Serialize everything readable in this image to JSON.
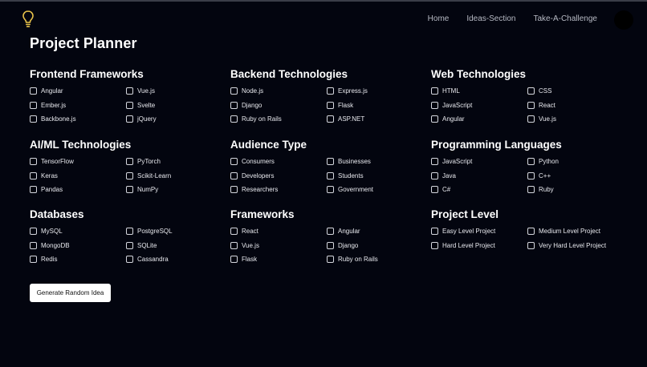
{
  "nav": {
    "links": [
      "Home",
      "Ideas-Section",
      "Take-A-Challenge"
    ],
    "logo_icon": "lightbulb-icon",
    "accent": "#e8c24a"
  },
  "page": {
    "title": "Project Planner"
  },
  "sections": [
    {
      "title": "Frontend Frameworks",
      "options": [
        "Angular",
        "Vue.js",
        "Ember.js",
        "Svelte",
        "Backbone.js",
        "jQuery"
      ]
    },
    {
      "title": "Backend Technologies",
      "options": [
        "Node.js",
        "Express.js",
        "Django",
        "Flask",
        "Ruby on Rails",
        "ASP.NET"
      ]
    },
    {
      "title": "Web Technologies",
      "options": [
        "HTML",
        "CSS",
        "JavaScript",
        "React",
        "Angular",
        "Vue.js"
      ]
    },
    {
      "title": "AI/ML Technologies",
      "options": [
        "TensorFlow",
        "PyTorch",
        "Keras",
        "Scikit-Learn",
        "Pandas",
        "NumPy"
      ]
    },
    {
      "title": "Audience Type",
      "options": [
        "Consumers",
        "Businesses",
        "Developers",
        "Students",
        "Researchers",
        "Government"
      ]
    },
    {
      "title": "Programming Languages",
      "options": [
        "JavaScript",
        "Python",
        "Java",
        "C++",
        "C#",
        "Ruby"
      ]
    },
    {
      "title": "Databases",
      "options": [
        "MySQL",
        "PostgreSQL",
        "MongoDB",
        "SQLite",
        "Redis",
        "Cassandra"
      ]
    },
    {
      "title": "Frameworks",
      "options": [
        "React",
        "Angular",
        "Vue.js",
        "Django",
        "Flask",
        "Ruby on Rails"
      ]
    },
    {
      "title": "Project Level",
      "options": [
        "Easy Level Project",
        "Medium Level Project",
        "Hard Level Project",
        "Very Hard Level Project"
      ]
    }
  ],
  "generate_button": {
    "label": "Generate Random Idea"
  }
}
